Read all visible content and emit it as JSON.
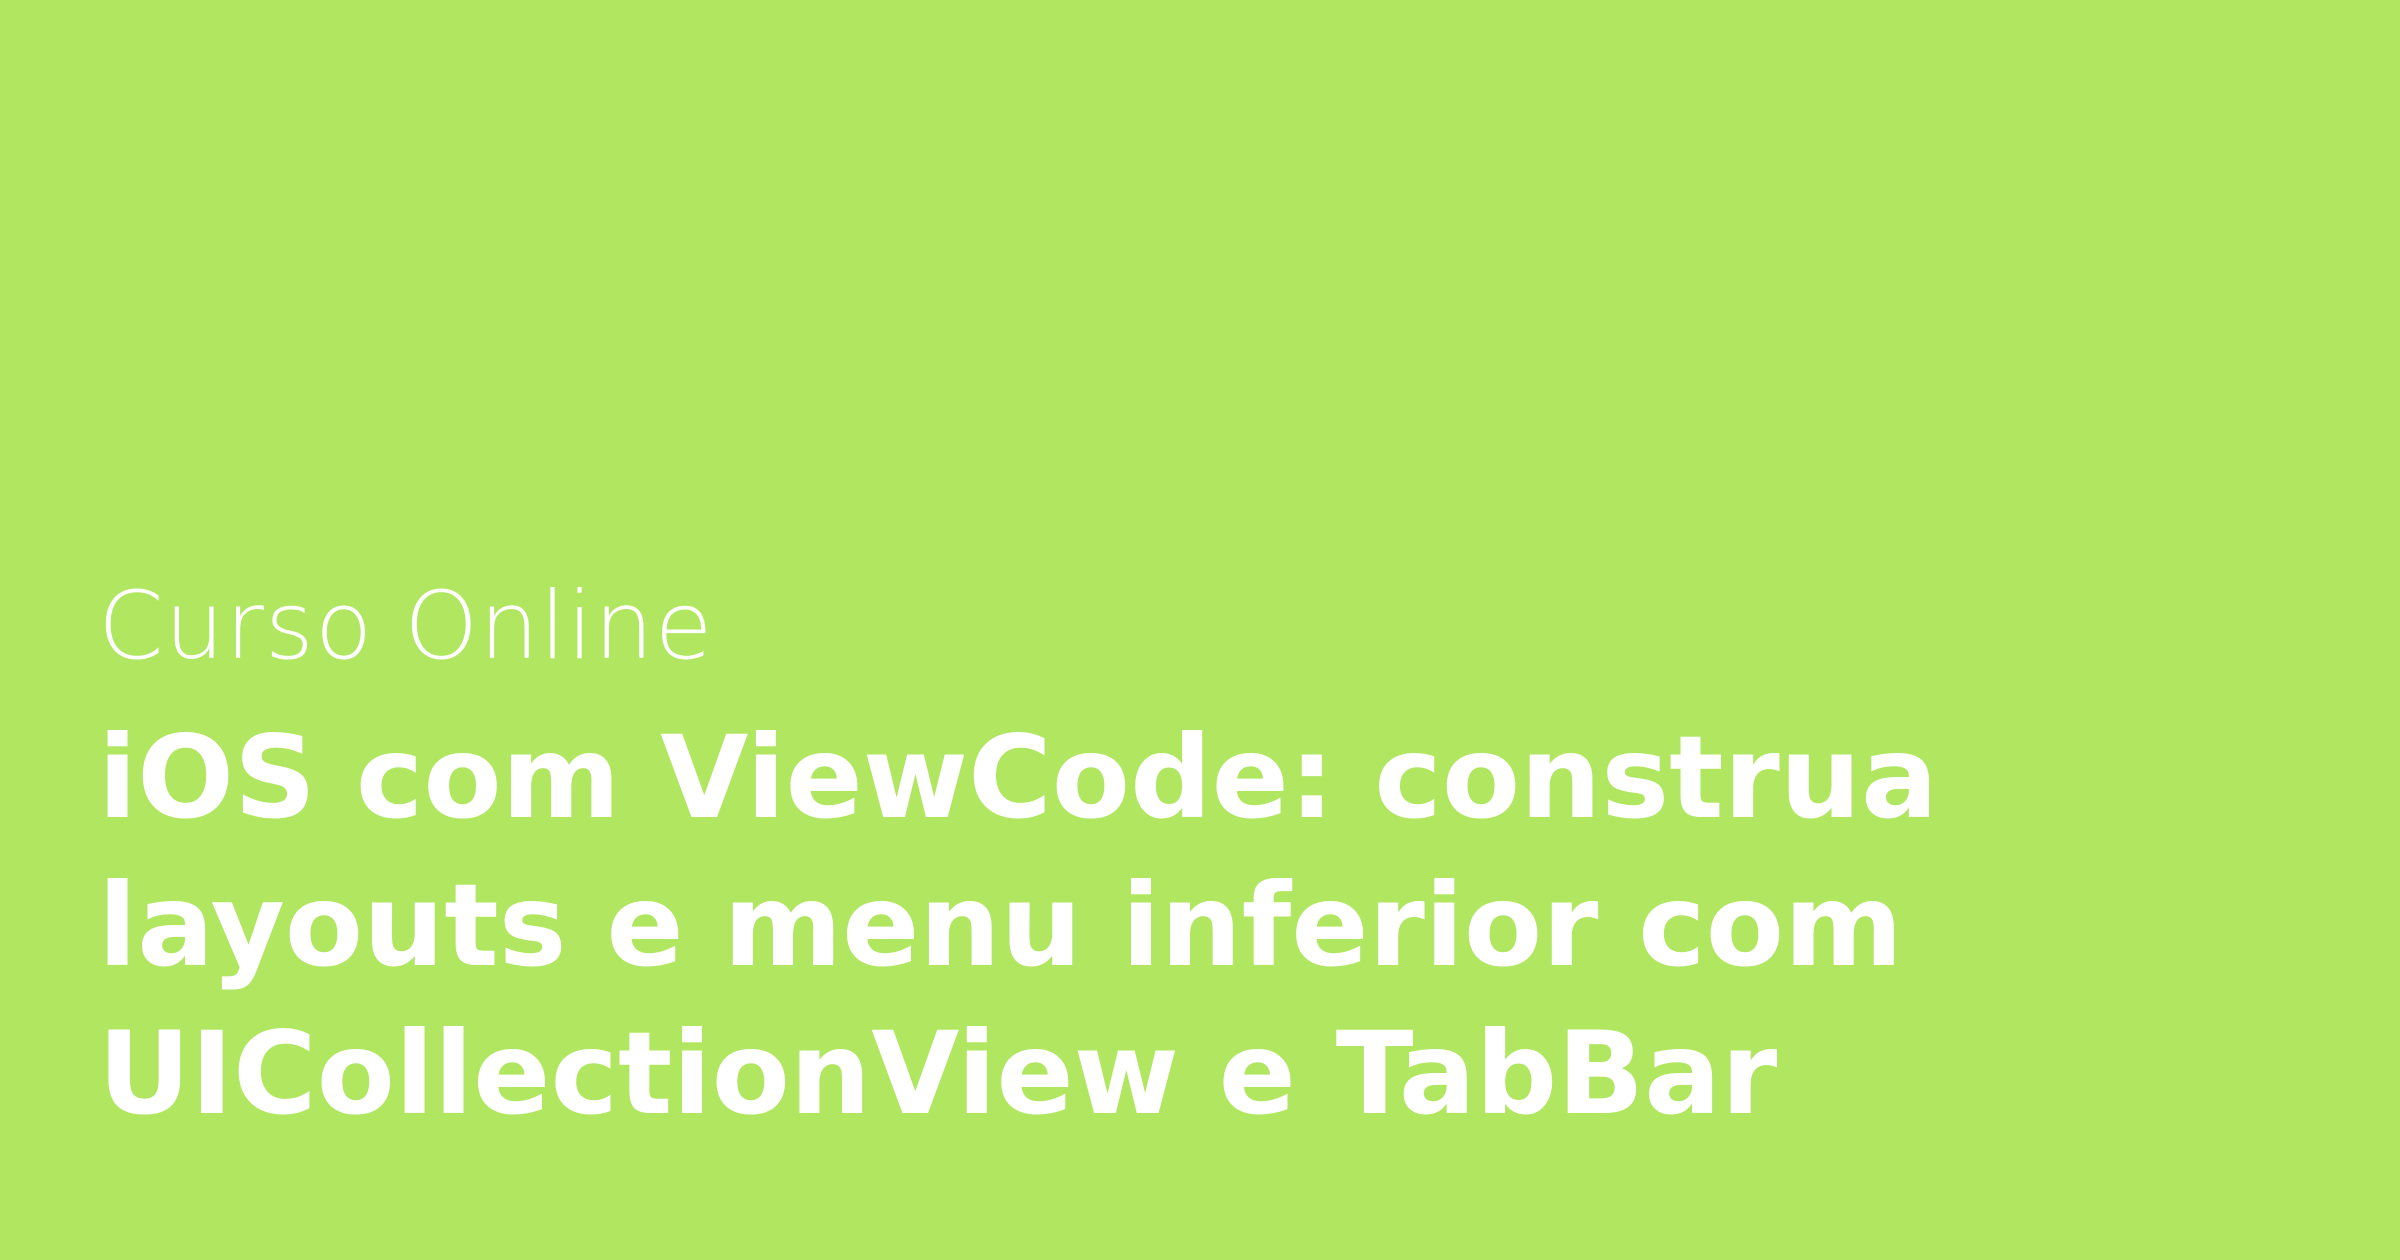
{
  "background_color": "#b0e660",
  "text_color": "#ffffff",
  "kicker": "Curso Online",
  "title_lines": [
    "iOS com ViewCode: construa",
    "layouts e menu inferior com",
    "UICollectionView e TabBar"
  ]
}
